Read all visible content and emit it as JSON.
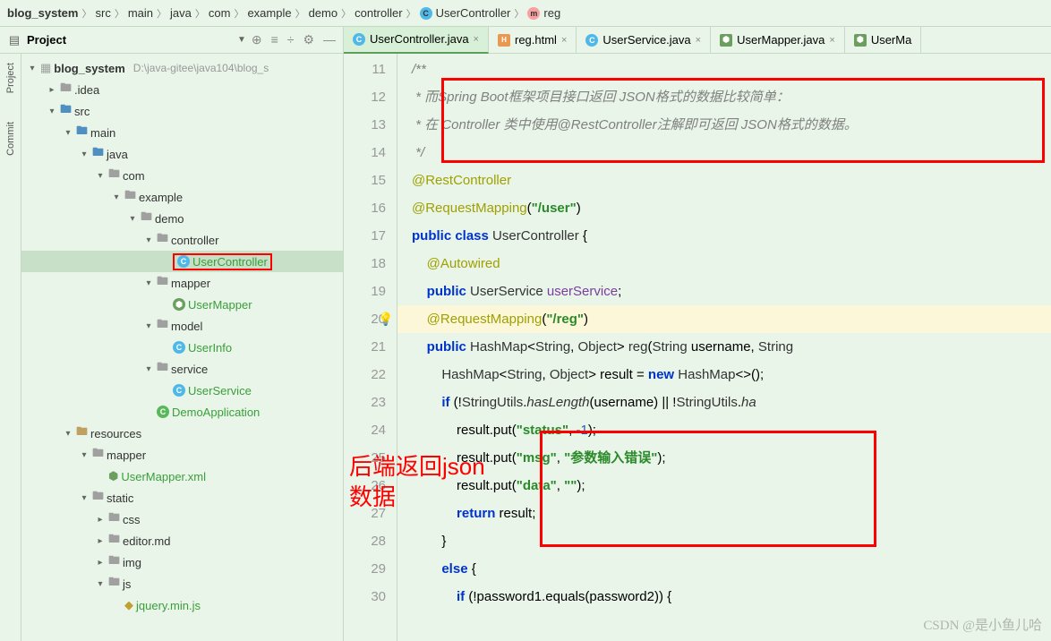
{
  "breadcrumb": {
    "items": [
      "blog_system",
      "src",
      "main",
      "java",
      "com",
      "example",
      "demo",
      "controller",
      "UserController",
      "reg"
    ]
  },
  "project_header": {
    "title": "Project"
  },
  "sidebar_tabs": {
    "project": "Project",
    "commit": "Commit"
  },
  "tabs": [
    {
      "label": "UserController.java",
      "type": "java",
      "active": true
    },
    {
      "label": "reg.html",
      "type": "html",
      "active": false
    },
    {
      "label": "UserService.java",
      "type": "java",
      "active": false
    },
    {
      "label": "UserMapper.java",
      "type": "gradle",
      "active": false
    },
    {
      "label": "UserMa",
      "type": "gradle",
      "active": false,
      "cut": true
    }
  ],
  "tree": {
    "root": {
      "label": "blog_system",
      "path": "D:\\java-gitee\\java104\\blog_s"
    },
    "items": [
      {
        "indent": 1,
        "icon": "folder-gray",
        "label": ".idea",
        "arrow": ">"
      },
      {
        "indent": 1,
        "icon": "folder-blue",
        "label": "src",
        "arrow": "v"
      },
      {
        "indent": 2,
        "icon": "folder-blue",
        "label": "main",
        "arrow": "v"
      },
      {
        "indent": 3,
        "icon": "folder-blue",
        "label": "java",
        "arrow": "v"
      },
      {
        "indent": 4,
        "icon": "folder-gray",
        "label": "com",
        "arrow": "v"
      },
      {
        "indent": 5,
        "icon": "folder-gray",
        "label": "example",
        "arrow": "v"
      },
      {
        "indent": 6,
        "icon": "folder-gray",
        "label": "demo",
        "arrow": "v"
      },
      {
        "indent": 7,
        "icon": "folder-gray",
        "label": "controller",
        "arrow": "v"
      },
      {
        "indent": 8,
        "icon": "class",
        "label": "UserController",
        "green": true,
        "selected": true,
        "boxed": true
      },
      {
        "indent": 7,
        "icon": "folder-gray",
        "label": "mapper",
        "arrow": "v"
      },
      {
        "indent": 8,
        "icon": "interface",
        "label": "UserMapper",
        "green": true
      },
      {
        "indent": 7,
        "icon": "folder-gray",
        "label": "model",
        "arrow": "v"
      },
      {
        "indent": 8,
        "icon": "class",
        "label": "UserInfo",
        "green": true
      },
      {
        "indent": 7,
        "icon": "folder-gray",
        "label": "service",
        "arrow": "v"
      },
      {
        "indent": 8,
        "icon": "class",
        "label": "UserService",
        "green": true
      },
      {
        "indent": 7,
        "icon": "class-run",
        "label": "DemoApplication",
        "green": true
      },
      {
        "indent": 2,
        "icon": "folder-tan",
        "label": "resources",
        "arrow": "v"
      },
      {
        "indent": 3,
        "icon": "folder-gray",
        "label": "mapper",
        "arrow": "v"
      },
      {
        "indent": 4,
        "icon": "xml",
        "label": "UserMapper.xml",
        "green": true
      },
      {
        "indent": 3,
        "icon": "folder-gray",
        "label": "static",
        "arrow": "v"
      },
      {
        "indent": 4,
        "icon": "folder-gray",
        "label": "css",
        "arrow": ">"
      },
      {
        "indent": 4,
        "icon": "folder-gray",
        "label": "editor.md",
        "arrow": ">"
      },
      {
        "indent": 4,
        "icon": "folder-gray",
        "label": "img",
        "arrow": ">"
      },
      {
        "indent": 4,
        "icon": "folder-gray",
        "label": "js",
        "arrow": "v"
      },
      {
        "indent": 5,
        "icon": "js",
        "label": "jquery.min.js",
        "green": true
      }
    ]
  },
  "code": {
    "lines": [
      {
        "n": 11,
        "html": "<span class='comment'>/**</span>"
      },
      {
        "n": 12,
        "html": " <span class='comment'>* 而Spring Boot框架项目接口返回 JSON格式的数据比较简单：</span>"
      },
      {
        "n": 13,
        "html": " <span class='comment'>* 在 Controller 类中使用@RestController注解即可返回 JSON格式的数据。</span>"
      },
      {
        "n": 14,
        "html": " <span class='comment'>*/</span>"
      },
      {
        "n": 15,
        "html": "<span class='annotation'>@RestController</span>"
      },
      {
        "n": 16,
        "html": "<span class='annotation'>@RequestMapping</span>(<span class='string'>\"/user\"</span>)"
      },
      {
        "n": 17,
        "html": "<span class='keyword'>public class</span> <span class='name'>UserController</span> {"
      },
      {
        "n": 18,
        "html": "    <span class='annotation'>@Autowired</span>"
      },
      {
        "n": 19,
        "html": "    <span class='keyword'>public</span> <span class='type'>UserService</span> <span class='field'>userService</span>;"
      },
      {
        "n": 20,
        "html": "    <span class='annotation'>@RequestMapping</span>(<span class='string'>\"/reg\"</span>)",
        "hl": true,
        "bulb": true
      },
      {
        "n": 21,
        "html": "    <span class='keyword'>public</span> <span class='type'>HashMap</span>&lt;<span class='type'>String</span>, <span class='type'>Object</span>&gt; <span class='name'>reg</span>(<span class='type'>String</span> username, <span class='type'>String</span> "
      },
      {
        "n": 22,
        "html": "        <span class='type'>HashMap</span>&lt;<span class='type'>String</span>, <span class='type'>Object</span>&gt; result = <span class='keyword'>new</span> <span class='type'>HashMap</span>&lt;&gt;();"
      },
      {
        "n": 23,
        "html": "        <span class='keyword'>if</span> (!<span class='type'>StringUtils</span>.<span class='method'>hasLength</span>(username) || !<span class='type'>StringUtils</span>.<span class='method'>ha</span>"
      },
      {
        "n": 24,
        "html": "            result.put(<span class='string'>\"status\"</span>, <span class='num'>-1</span>);"
      },
      {
        "n": 25,
        "html": "            result.put(<span class='string'>\"msg\"</span>, <span class='string'>\"参数输入错误\"</span>);"
      },
      {
        "n": 26,
        "html": "            result.put(<span class='string'>\"data\"</span>, <span class='string'>\"\"</span>);"
      },
      {
        "n": 27,
        "html": "            <span class='keyword'>return</span> result;"
      },
      {
        "n": 28,
        "html": "        }"
      },
      {
        "n": 29,
        "html": "        <span class='keyword'>else</span> {"
      },
      {
        "n": 30,
        "html": "            <span class='keyword'>if</span> (!password1.equals(password2)) {"
      }
    ]
  },
  "overlay": {
    "text": "后端返回json\n数据"
  },
  "watermark": "CSDN @是小鱼儿哈"
}
